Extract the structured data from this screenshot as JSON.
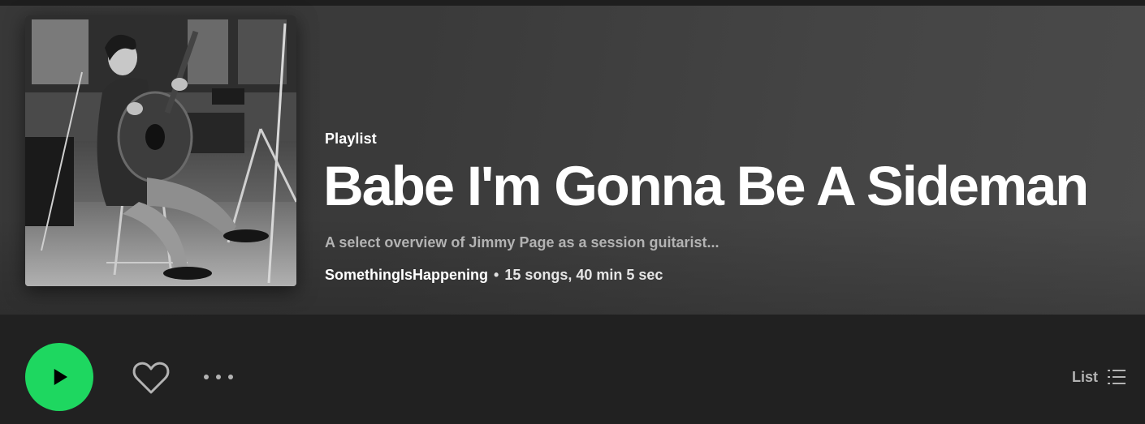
{
  "playlist": {
    "type_label": "Playlist",
    "title": "Babe I'm Gonna Be A Sideman",
    "description": "A select overview of Jimmy Page as a session guitarist...",
    "owner": "SomethingIsHappening",
    "separator": "•",
    "stats": "15 songs, 40 min 5 sec",
    "cover_icon": "album-cover-image"
  },
  "actions": {
    "play_icon": "play-icon",
    "like_icon": "heart-icon",
    "more_icon": "more-options-icon",
    "view_label": "List",
    "view_icon": "list-view-icon"
  },
  "colors": {
    "accent": "#1ed760",
    "background": "#212121",
    "header_bg": "#404040",
    "muted_text": "#b3b3b3"
  }
}
